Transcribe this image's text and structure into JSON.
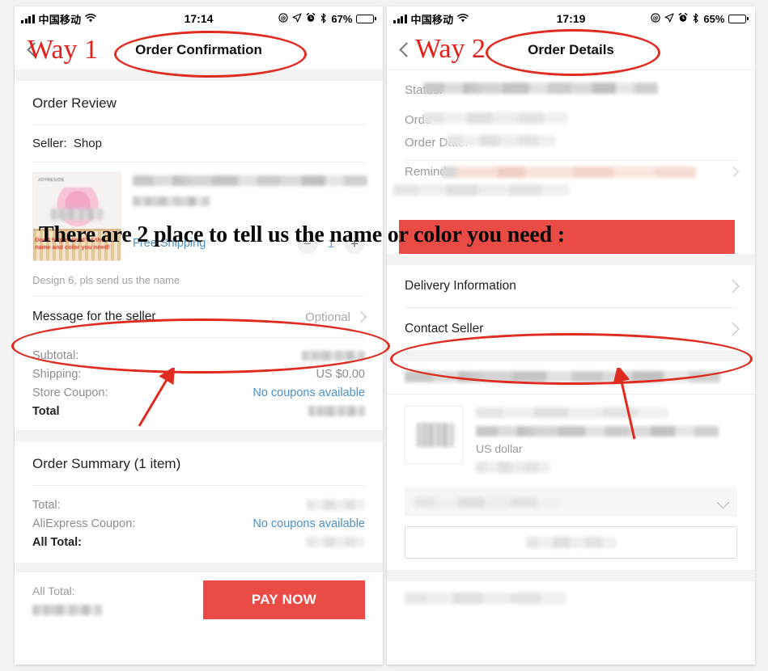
{
  "overlay": {
    "headline": "There are 2 place to tell us the name or color you need :",
    "way1_label": "Way 1",
    "way2_label": "Way 2",
    "accent_color": "#e32119",
    "band_color": "#ea4c45"
  },
  "left_phone": {
    "statusbar": {
      "carrier": "中国移动",
      "time": "17:14",
      "battery_percent": "67%",
      "icons": [
        "signal-bars-icon",
        "wifi-icon",
        "rotation-lock-icon",
        "location-arrow-icon",
        "alarm-clock-icon",
        "bluetooth-icon",
        "battery-icon"
      ]
    },
    "nav": {
      "title": "Order Confirmation",
      "back": "back-chevron"
    },
    "order_review": {
      "title": "Order Review",
      "seller_label": "Seller:",
      "seller_name": "Shop",
      "product": {
        "thumb_brand": "JOYRESIDE",
        "thumb_note": "Don't forget send us the name and color you need!",
        "shipping": "Free Shipping",
        "variant": "Design 6, pls send us the name",
        "qty": "1",
        "minus": "−",
        "plus": "+"
      },
      "message_row": {
        "label": "Message for the seller",
        "value": "Optional"
      },
      "price_lines": [
        {
          "label": "Subtotal:",
          "value": "",
          "redacted": true,
          "bold": false
        },
        {
          "label": "Shipping:",
          "value": "US $0.00",
          "redacted": false,
          "bold": false
        },
        {
          "label": "Store Coupon:",
          "value": "No coupons available",
          "redacted": false,
          "bold": false,
          "link": true
        },
        {
          "label": "Total",
          "value": "",
          "redacted": true,
          "bold": true
        }
      ]
    },
    "order_summary": {
      "title": "Order Summary (1 item)",
      "lines": [
        {
          "label": "Total:",
          "value": "",
          "redacted": true,
          "bold": false
        },
        {
          "label": "AliExpress Coupon:",
          "value": "No coupons available",
          "redacted": false,
          "bold": false,
          "link": true
        },
        {
          "label": "All Total:",
          "value": "",
          "redacted": true,
          "bold": true
        }
      ]
    },
    "paybar": {
      "total_label": "All Total:",
      "total_value": "",
      "button": "PAY NOW"
    }
  },
  "right_phone": {
    "statusbar": {
      "carrier": "中国移动",
      "time": "17:19",
      "battery_percent": "65%"
    },
    "nav": {
      "title": "Order Details",
      "back": "back-chevron"
    },
    "order_head": {
      "status_label": "Status:",
      "order_label": "Orde",
      "order_date_label": "Order Date:",
      "reminder_label": "Reminder:"
    },
    "nav_items": [
      {
        "label": "Delivery Information"
      },
      {
        "label": "Contact Seller"
      }
    ],
    "product": {
      "currency": "US dollar"
    }
  }
}
